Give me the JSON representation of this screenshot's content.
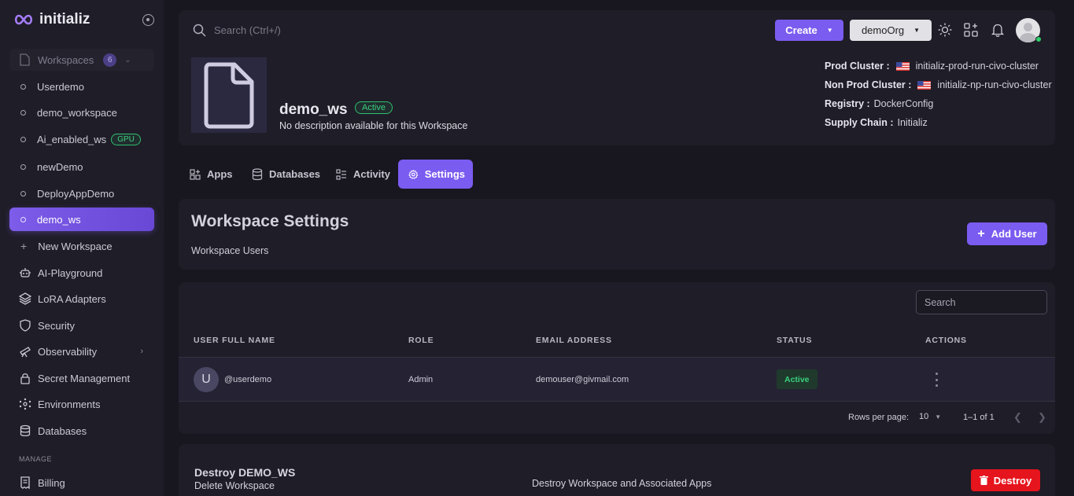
{
  "brand": {
    "name": "initializ"
  },
  "sidebar": {
    "workspaces_label": "Workspaces",
    "workspaces_count": "6",
    "workspaces": [
      {
        "label": "Userdemo"
      },
      {
        "label": "demo_workspace"
      },
      {
        "label": "Ai_enabled_ws",
        "badge": "GPU"
      },
      {
        "label": "newDemo"
      },
      {
        "label": "DeployAppDemo"
      },
      {
        "label": "demo_ws",
        "active": true
      }
    ],
    "new_workspace": "New Workspace",
    "nav": [
      {
        "label": "AI-Playground",
        "icon": "robot-icon"
      },
      {
        "label": "LoRA Adapters",
        "icon": "layers-icon"
      },
      {
        "label": "Security",
        "icon": "shield-icon"
      },
      {
        "label": "Observability",
        "icon": "telescope-icon"
      },
      {
        "label": "Secret Management",
        "icon": "lock-icon"
      },
      {
        "label": "Environments",
        "icon": "network-icon"
      },
      {
        "label": "Databases",
        "icon": "database-icon"
      }
    ],
    "manage_label": "MANAGE",
    "billing": "Billing"
  },
  "header": {
    "search_placeholder": "Search (Ctrl+/)",
    "create_label": "Create",
    "org_label": "demoOrg"
  },
  "workspace": {
    "name": "demo_ws",
    "status": "Active",
    "description": "No description available for this Workspace",
    "prod_cluster_label": "Prod Cluster :",
    "prod_cluster": "initializ-prod-run-civo-cluster",
    "nonprod_cluster_label": "Non Prod Cluster :",
    "nonprod_cluster": "initializ-np-run-civo-cluster",
    "registry_label": "Registry :",
    "registry": "DockerConfig",
    "supply_chain_label": "Supply Chain :",
    "supply_chain": "Initializ"
  },
  "tabs": [
    {
      "label": "Apps"
    },
    {
      "label": "Databases"
    },
    {
      "label": "Activity"
    },
    {
      "label": "Settings",
      "active": true
    }
  ],
  "settings": {
    "title": "Workspace Settings",
    "subtitle": "Workspace Users",
    "add_user": "Add User"
  },
  "users_table": {
    "search_placeholder": "Search",
    "columns": [
      "USER FULL NAME",
      "ROLE",
      "EMAIL ADDRESS",
      "STATUS",
      "ACTIONS"
    ],
    "rows": [
      {
        "initial": "U",
        "name": "@userdemo",
        "role": "Admin",
        "email": "demouser@givmail.com",
        "status": "Active"
      }
    ],
    "rows_per_page_label": "Rows per page:",
    "rows_per_page": "10",
    "range": "1–1 of 1"
  },
  "destroy": {
    "title": "Destroy DEMO_WS",
    "subtitle": "Delete Workspace",
    "description": "Destroy Workspace and Associated Apps",
    "button": "Destroy"
  },
  "colors": {
    "accent": "#7b5cf0",
    "success": "#3ad07e",
    "danger": "#e6141c",
    "background": "#18161f",
    "card": "#1f1d27"
  }
}
